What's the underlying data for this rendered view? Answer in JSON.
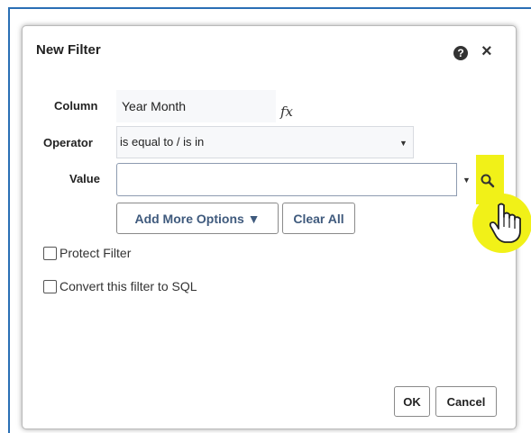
{
  "dialog": {
    "title": "New Filter",
    "help_icon": "?",
    "close_icon": "×"
  },
  "form": {
    "column_label": "Column",
    "column_value": "Year Month",
    "fx_label": "fx",
    "operator_label": "Operator",
    "operator_value": "is equal to / is in",
    "value_label": "Value",
    "value_input": "",
    "add_more_options_label": "Add More Options ▼",
    "clear_all_label": "Clear All",
    "protect_filter_label": "Protect Filter",
    "convert_sql_label": "Convert this filter to SQL"
  },
  "footer": {
    "ok_label": "OK",
    "cancel_label": "Cancel"
  },
  "colors": {
    "highlight": "#f1f118",
    "link_button_text": "#3f5a7d",
    "frame_accent": "#2a6fb5"
  }
}
